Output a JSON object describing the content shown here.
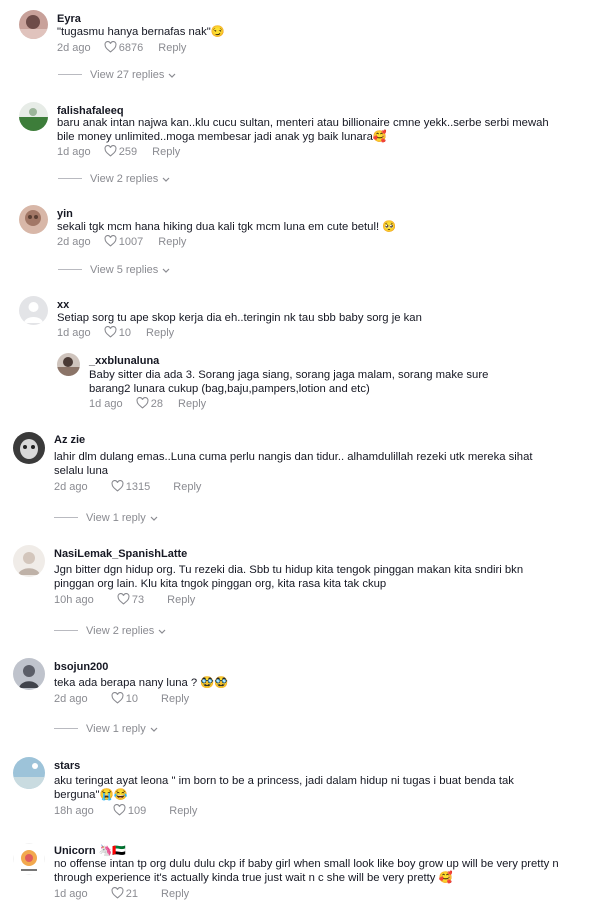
{
  "comments": [
    {
      "user": "Eyra",
      "text": "\"tugasmu hanya bernafas nak\"😏",
      "age": "2d ago",
      "likes": "6876",
      "reply": "Reply",
      "view": "View 27 replies"
    },
    {
      "user": "falishafaleeq",
      "text": "baru anak intan najwa kan..klu cucu sultan, menteri atau billionaire cmne yekk..serbe serbi mewah bile money unlimited..moga membesar jadi anak yg baik lunara🥰",
      "age": "1d ago",
      "likes": "259",
      "reply": "Reply",
      "view": "View 2 replies"
    },
    {
      "user": "yin",
      "text": "sekali tgk mcm hana hiking dua kali tgk mcm luna em cute betul! 🥺",
      "age": "2d ago",
      "likes": "1007",
      "reply": "Reply",
      "view": "View 5 replies"
    },
    {
      "user": "xx",
      "text": "Setiap sorg tu ape skop kerja dia eh..teringin nk tau sbb baby sorg je kan",
      "age": "1d ago",
      "likes": "10",
      "reply": "Reply"
    },
    {
      "user": "_xxblunaluna",
      "text": "Baby sitter dia ada 3. Sorang jaga siang, sorang jaga malam, sorang make sure barang2 lunara cukup (bag,baju,pampers,lotion and etc)",
      "age": "1d ago",
      "likes": "28",
      "reply": "Reply"
    },
    {
      "user": "Az zie",
      "text": "lahir dlm dulang emas..Luna cuma perlu nangis dan tidur.. alhamdulillah rezeki utk mereka sihat selalu luna",
      "age": "2d ago",
      "likes": "1315",
      "reply": "Reply",
      "view": "View 1 reply"
    },
    {
      "user": "NasiLemak_SpanishLatte",
      "text": "Jgn bitter dgn hidup org. Tu rezeki dia. Sbb tu hidup kita tengok pinggan makan kita sndiri bkn pinggan org lain. Klu kita tngok pinggan org, kita rasa kita tak ckup",
      "age": "10h ago",
      "likes": "73",
      "reply": "Reply",
      "view": "View 2 replies"
    },
    {
      "user": "bsojun200",
      "text": "teka ada berapa nany luna ? 🥸🥸",
      "age": "2d ago",
      "likes": "10",
      "reply": "Reply",
      "view": "View 1 reply"
    },
    {
      "user": "stars",
      "text": "aku teringat ayat leona \" im born to be a princess, jadi dalam hidup ni tugas i buat benda tak berguna\"😭😂",
      "age": "18h ago",
      "likes": "109",
      "reply": "Reply"
    },
    {
      "user": "Unicorn",
      "flag": "🦄🇦🇪",
      "text": "no offense intan tp org dulu dulu ckp if baby girl when small look like boy grow up will be very pretty n through experience it's actually kinda true just wait n c she will be very pretty 🥰",
      "age": "1d ago",
      "likes": "21",
      "reply": "Reply"
    }
  ],
  "colors": {
    "text": "#161823",
    "muted": "#8a8b91"
  }
}
